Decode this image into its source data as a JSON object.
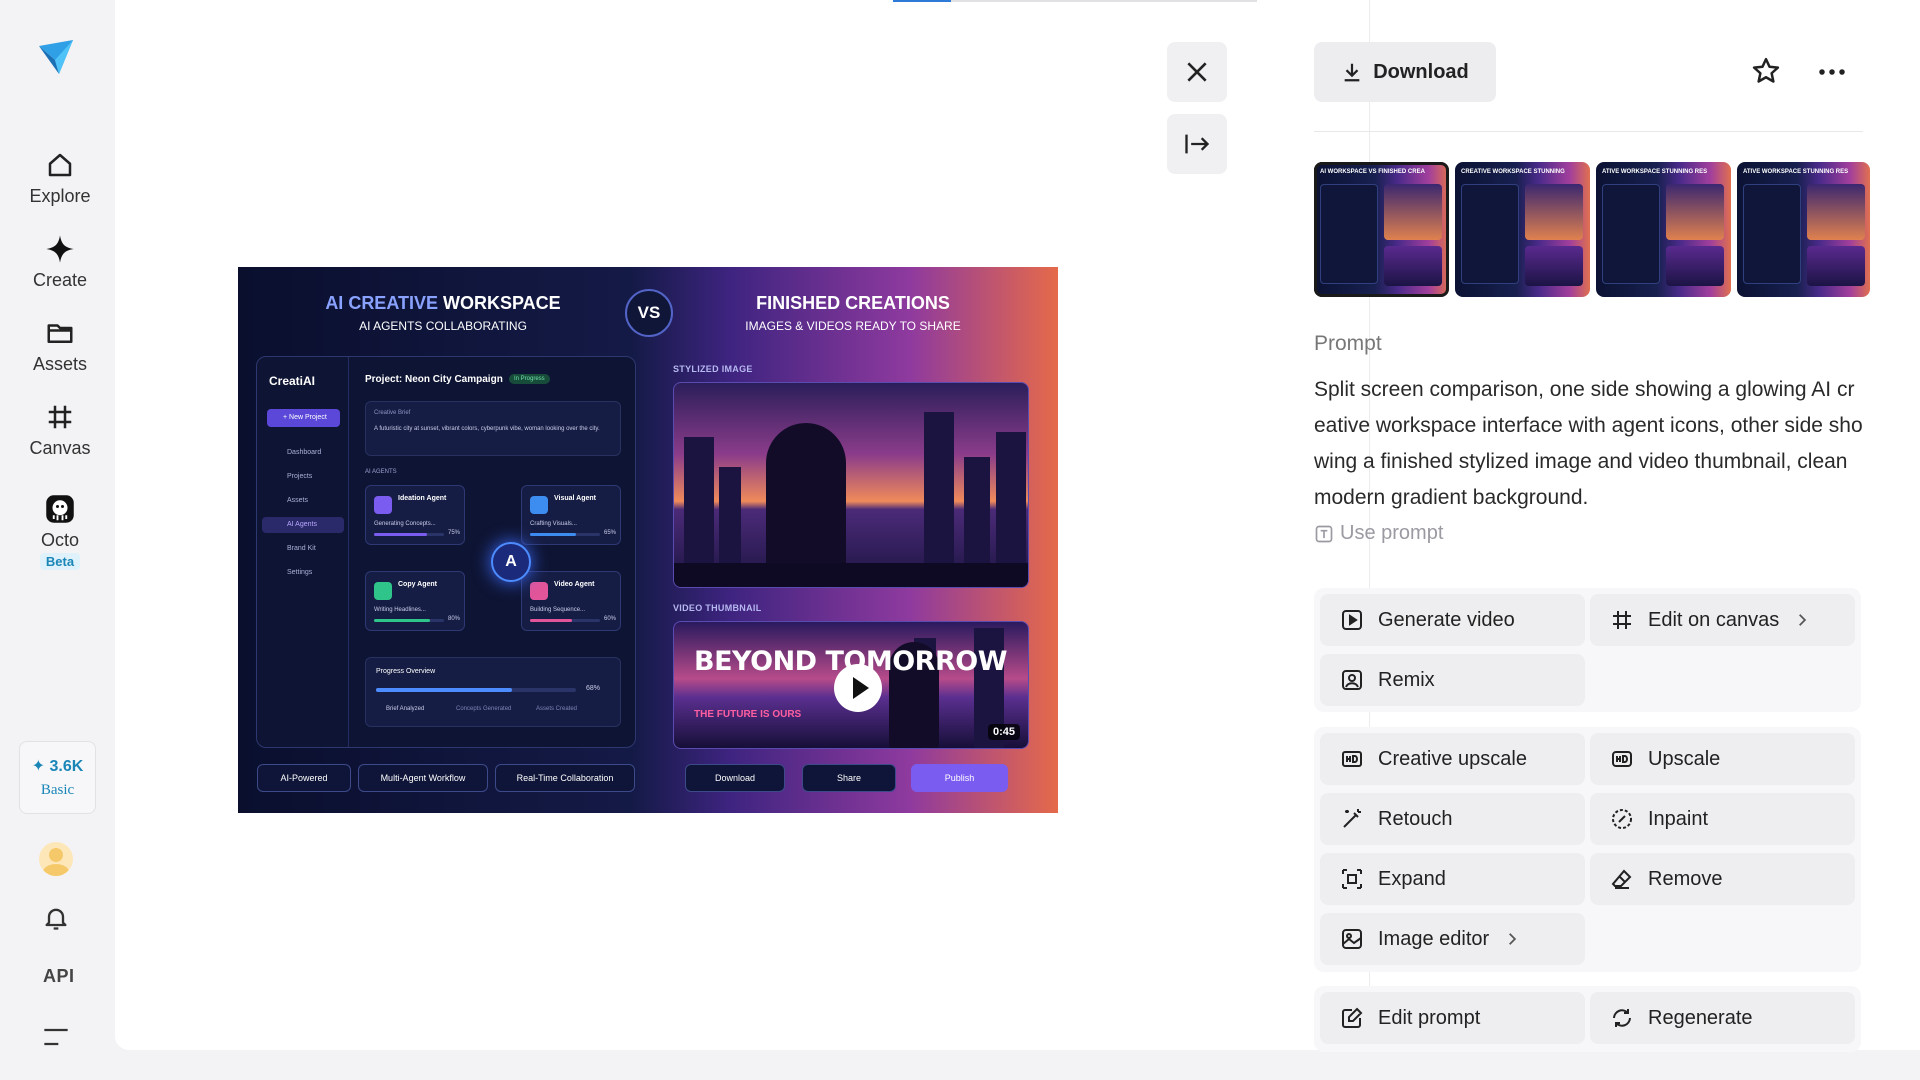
{
  "nav": {
    "items": [
      {
        "label": "Explore",
        "icon": "home-icon"
      },
      {
        "label": "Create",
        "icon": "sparkle-icon"
      },
      {
        "label": "Assets",
        "icon": "folder-icon"
      },
      {
        "label": "Canvas",
        "icon": "frame-icon"
      },
      {
        "label": "Octo",
        "icon": "octo-icon",
        "badge": "Beta"
      }
    ],
    "credits": {
      "amount": "✦ 3.6K",
      "plan": "Basic"
    },
    "api_label": "API"
  },
  "viewer": {
    "progress_fraction": 0.16,
    "close_icon": "close-icon",
    "collapse_icon": "collapse-panel-icon"
  },
  "image": {
    "left_title_a": "AI CREATIVE",
    "left_title_b": " WORKSPACE",
    "left_sub": "AI AGENTS COLLABORATING",
    "vs": "VS",
    "right_title": "FINISHED CREATIONS",
    "right_sub": "IMAGES & VIDEOS READY TO SHARE",
    "app_name": "CreatiAI",
    "new_project": "+ New Project",
    "menu": [
      "Dashboard",
      "Projects",
      "Assets",
      "AI Agents",
      "Brand Kit",
      "Settings"
    ],
    "project_title": "Project: Neon City Campaign",
    "project_status": "In Progress",
    "brief_label": "Creative Brief",
    "brief_text": "A futuristic city at sunset, vibrant colors, cyberpunk vibe, woman looking over the city.",
    "agents_label": "AI AGENTS",
    "agents": [
      {
        "name": "Ideation Agent",
        "task": "Generating Concepts...",
        "pct": "75%",
        "fill": 0.75,
        "color": "#7b5cf0"
      },
      {
        "name": "Visual Agent",
        "task": "Crafting Visuals...",
        "pct": "65%",
        "fill": 0.65,
        "color": "#3d8cf0"
      },
      {
        "name": "Copy Agent",
        "task": "Writing Headlines...",
        "pct": "80%",
        "fill": 0.8,
        "color": "#2fc48a"
      },
      {
        "name": "Video Agent",
        "task": "Building Sequence...",
        "pct": "60%",
        "fill": 0.6,
        "color": "#e2559a"
      }
    ],
    "hub_label": "A",
    "progress_title": "Progress Overview",
    "progress_pct": "68%",
    "progress_fill": 0.68,
    "progress_steps": [
      "Brief Analyzed",
      "Concepts Generated",
      "Assets Created"
    ],
    "pills": [
      "AI-Powered",
      "Multi-Agent Workflow",
      "Real-Time Collaboration"
    ],
    "stylized_label": "STYLIZED IMAGE",
    "video_label": "VIDEO THUMBNAIL",
    "video_title": "BEYOND TOMORROW",
    "video_sub": "THE FUTURE IS OURS",
    "video_duration": "0:45",
    "actions": [
      "Download",
      "Share",
      "Publish"
    ]
  },
  "panel": {
    "download_label": "Download",
    "thumbs": [
      {
        "caption": "AI WORKSPACE  VS  FINISHED CREA",
        "selected": true
      },
      {
        "caption": "CREATIVE WORKSPACE  STUNNING",
        "selected": false
      },
      {
        "caption": "ATIVE WORKSPACE  STUNNING RES",
        "selected": false
      },
      {
        "caption": "ATIVE WORKSPACE  STUNNING RES",
        "selected": false
      }
    ],
    "prompt_label": "Prompt",
    "prompt_text": "Split screen comparison, one side showing a glowing AI creative workspace interface with agent icons, other side showing a finished stylized image and video thumbnail, clean modern gradient background.",
    "use_prompt": "Use prompt",
    "group1": [
      "Generate video",
      "Edit on canvas",
      "Remix"
    ],
    "group2": [
      "Creative upscale",
      "Upscale",
      "Retouch",
      "Inpaint",
      "Expand",
      "Remove",
      "Image editor"
    ],
    "group3": [
      "Edit prompt",
      "Regenerate"
    ]
  }
}
